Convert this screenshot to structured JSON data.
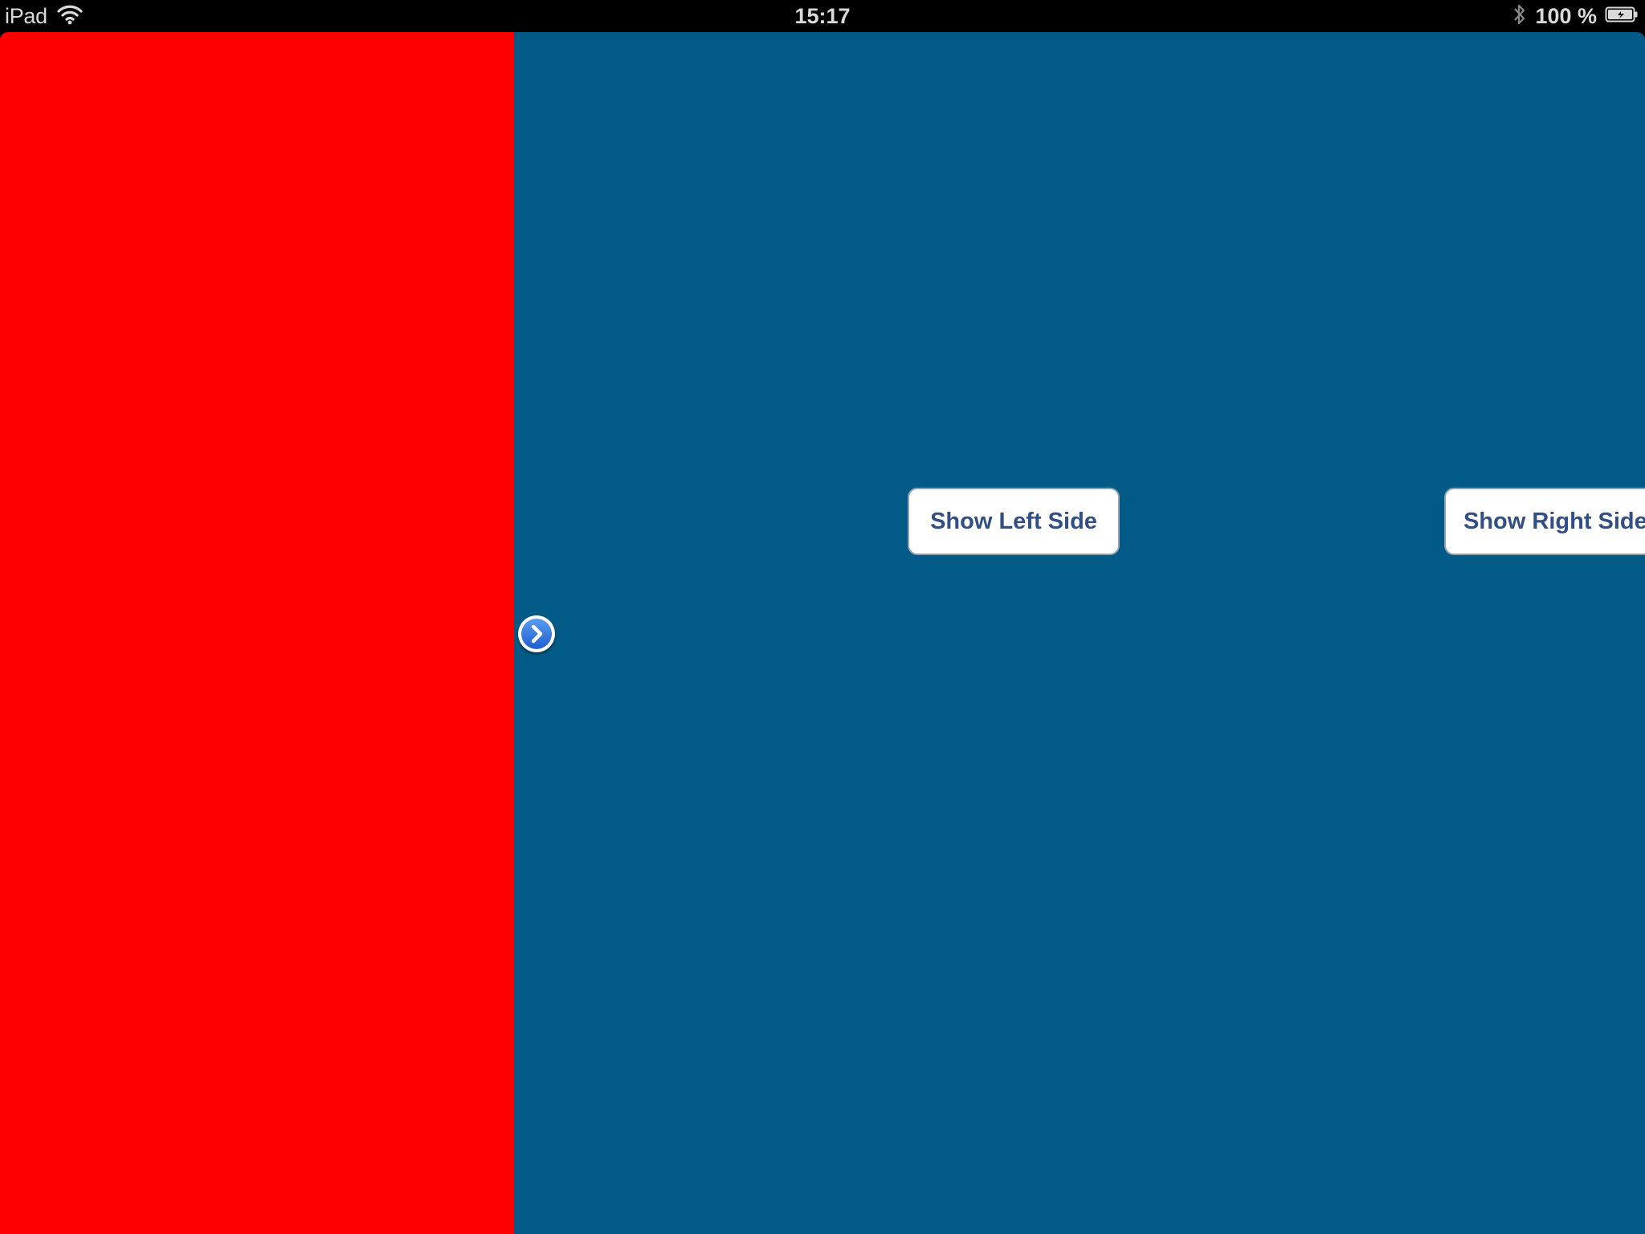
{
  "status_bar": {
    "device": "iPad",
    "time": "15:17",
    "battery": "100 %",
    "icons": [
      "wifi-icon",
      "bluetooth-icon",
      "battery-icon"
    ]
  },
  "left_panel": {
    "color": "#ff0000"
  },
  "right_panel": {
    "color": "#025a86",
    "show_left_label": "Show Left Side",
    "show_right_label": "Show Right Side",
    "disclosure_icon": "chevron-right-icon"
  },
  "colors": {
    "button_text": "#324f85",
    "disclosure_blue": "#2f74dd"
  }
}
